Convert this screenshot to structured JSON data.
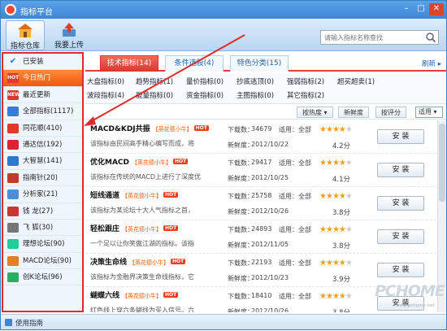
{
  "window": {
    "title": "指标平台"
  },
  "toolbar": {
    "warehouse": "指标仓库",
    "upload": "我要上传",
    "search_placeholder": "请输入指标名称查找"
  },
  "sidebar": {
    "items": [
      {
        "label": "已安装",
        "icon": "check-icon",
        "badge": "✔"
      },
      {
        "label": "今日热门",
        "icon": "hot-icon",
        "badge": "HOT"
      },
      {
        "label": "最近更新",
        "icon": "new-icon",
        "badge": "NEW"
      },
      {
        "label": "全部指标(1117)",
        "icon": "grid-icon",
        "badge": ""
      },
      {
        "label": "同花顺(410)",
        "icon": "tonghuashun-icon",
        "badge": ""
      },
      {
        "label": "通达信(192)",
        "icon": "tongdaxin-icon",
        "badge": ""
      },
      {
        "label": "大智慧(141)",
        "icon": "dazhihui-icon",
        "badge": ""
      },
      {
        "label": "指南针(20)",
        "icon": "compass-icon",
        "badge": ""
      },
      {
        "label": "分析家(21)",
        "icon": "analyst-icon",
        "badge": ""
      },
      {
        "label": "钱  龙(27)",
        "icon": "qianlong-icon",
        "badge": ""
      },
      {
        "label": "飞  狐(30)",
        "icon": "feihu-icon",
        "badge": ""
      },
      {
        "label": "理想论坛(90)",
        "icon": "lixiang-icon",
        "badge": ""
      },
      {
        "label": "MACD论坛(90)",
        "icon": "macd-icon",
        "badge": ""
      },
      {
        "label": "创K论坛(96)",
        "icon": "chuangk-icon",
        "badge": ""
      }
    ],
    "selected_index": 1
  },
  "tabs": {
    "items": [
      "技术指标(14)",
      "条件选股(4)",
      "特色分类(15)"
    ],
    "active_index": 0,
    "refresh": "刷新"
  },
  "categories": [
    "大盘指标(0)",
    "趋势指标(1)",
    "量价指标(0)",
    "抄底逃顶(0)",
    "强弱指标(2)",
    "超买超卖(1)",
    "波段指标(4)",
    "能量指标(0)",
    "资金指标(0)",
    "主图指标(0)",
    "其它指标(2)"
  ],
  "sortbar": {
    "hot": "按热度",
    "new": "新鲜度",
    "score": "按评分",
    "filter": "适用"
  },
  "list_labels": {
    "downloads": "下载数：",
    "applies": "适用：",
    "freshness": "新鲜度：",
    "install": "安  装",
    "hot": "HOT"
  },
  "rows": [
    {
      "name": "MACD&KDJ共振",
      "author": "【英花德小牛】",
      "desc": "该指标由民间高手精心编写而成，将",
      "downloads": "34679",
      "applies": "全部",
      "date": "2012/10/22",
      "stars": 4,
      "score": "4.2分"
    },
    {
      "name": "优化MACD",
      "author": "【英花德小牛】",
      "desc": "该指标在传统的MACD上进行了深度优",
      "downloads": "29417",
      "applies": "全部",
      "date": "2012/10/25",
      "stars": 4,
      "score": "4.1分"
    },
    {
      "name": "短线通道",
      "author": "【英花德小牛】",
      "desc": "该指标为某论坛十大人气指标之首，",
      "downloads": "25758",
      "applies": "全部",
      "date": "2012/10/26",
      "stars": 4,
      "score": "3.8分"
    },
    {
      "name": "轻松跟庄",
      "author": "【英花德小牛】",
      "desc": "一个足以让你笑傲江湖的指标。该指",
      "downloads": "24893",
      "applies": "全部",
      "date": "2012/11/05",
      "stars": 4,
      "score": "3.8分"
    },
    {
      "name": "决策生命线",
      "author": "【英花德小牛】",
      "desc": "该指标为金融界决策生命线指标，它",
      "downloads": "22193",
      "applies": "全部",
      "date": "2012/10/23",
      "stars": 4,
      "score": "3.9分"
    },
    {
      "name": "蝴蝶六线",
      "author": "【英花德小牛】",
      "desc": "红色线上穿六条蝴线为买入信号。六",
      "downloads": "18410",
      "applies": "全部",
      "date": "2012/10/26",
      "stars": 4,
      "score": "3.8分"
    }
  ],
  "status": {
    "guide": "使用指南"
  },
  "watermark": {
    "text": "PCHOME",
    "url": "www.pchome.net"
  },
  "colors": {
    "accent": "#3d86d5",
    "highlight": "#e02b2b",
    "selected": "#f05a0a"
  }
}
